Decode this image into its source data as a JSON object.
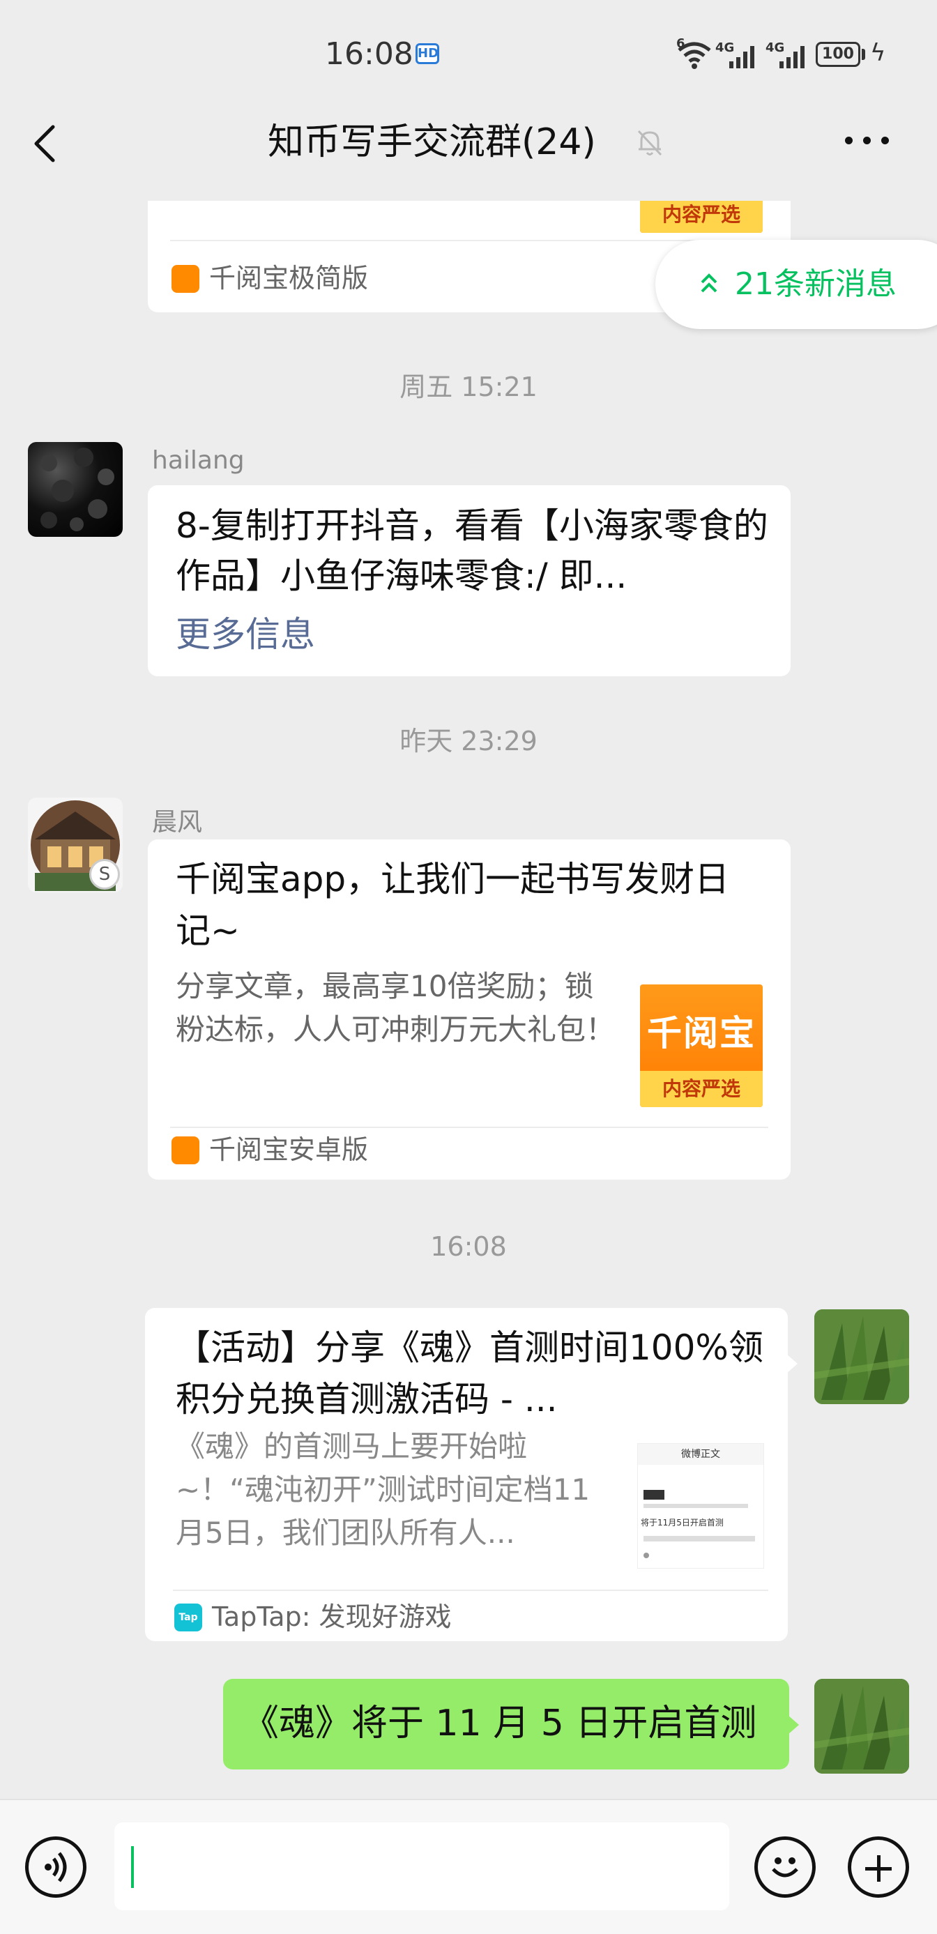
{
  "status_bar": {
    "time": "16:08",
    "hd_badge": "HD",
    "wifi_label": "6",
    "sim1_label": "4G",
    "sim2_label": "4G",
    "battery": "100"
  },
  "header": {
    "title": "知币写手交流群(24)",
    "icons": [
      "back-icon",
      "mute-bell-icon",
      "more-icon"
    ]
  },
  "new_messages": {
    "label": "21条新消息"
  },
  "messages": [
    {
      "type": "card-partial",
      "thumb_caption": "内容严选",
      "source": "千阅宝极简版"
    },
    {
      "type": "timestamp",
      "text": "周五 15:21"
    },
    {
      "type": "link-message",
      "sender": "hailang",
      "text": "8-复制打开抖音，看看【小海家零食的作品】小鱼仔海味零食:/ 即...",
      "link": "更多信息"
    },
    {
      "type": "timestamp",
      "text": "昨天 23:29"
    },
    {
      "type": "card",
      "sender": "晨风",
      "title": "千阅宝app，让我们一起书写发财日记~",
      "desc": "分享文章，最高享10倍奖励；锁粉达标，人人可冲刺万元大礼包！",
      "thumb_big": "千阅宝",
      "thumb_caption": "内容严选",
      "source": "千阅宝安卓版"
    },
    {
      "type": "timestamp",
      "text": "16:08"
    },
    {
      "type": "card-self",
      "title": "【活动】分享《魂》首测时间100%领积分兑换首测激活码 - ...",
      "desc": "《魂》的首测马上要开始啦~！“魂沌初开”测试时间定档11月5日，我们团队所有人...",
      "thumb_header": "微博正文",
      "thumb_line": "将于11月5日开启首测",
      "source": "TapTap: 发现好游戏",
      "source_icon_text": "Tap"
    },
    {
      "type": "text-self",
      "text": "《魂》将于 11 月 5 日开启首测"
    }
  ],
  "input_bar": {
    "icons": [
      "voice-icon",
      "emoji-icon",
      "plus-icon"
    ],
    "value": ""
  }
}
